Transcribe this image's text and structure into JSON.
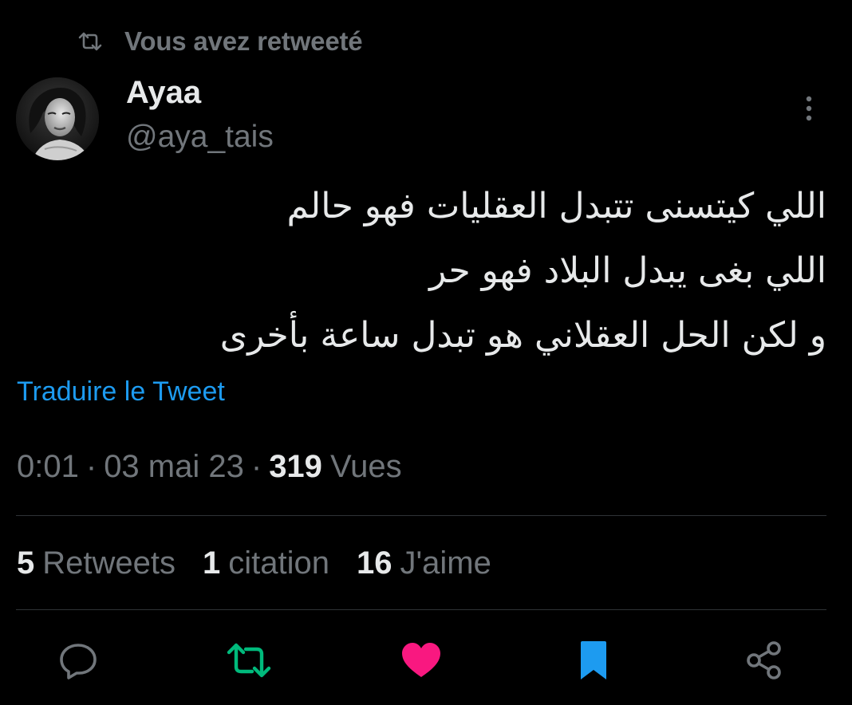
{
  "retweet_context": {
    "icon": "retweet-icon",
    "text": "Vous avez retweeté"
  },
  "author": {
    "display_name": "Ayaa",
    "handle": "@aya_tais",
    "avatar": "avatar-photo"
  },
  "more_icon": "more-vertical-icon",
  "tweet": {
    "lines": [
      "اللي كيتسنى تتبدل العقليات فهو حالم",
      "اللي بغى يبدل البلاد فهو حر",
      "و لكن الحل العقلاني هو تبدل ساعة بأخرى"
    ],
    "translate_label": "Traduire le Tweet"
  },
  "meta": {
    "time": "0:01",
    "separator": "·",
    "date": "03 mai 23",
    "views_count": "319",
    "views_label": "Vues"
  },
  "stats": {
    "retweets_count": "5",
    "retweets_label": "Retweets",
    "quotes_count": "1",
    "quotes_label": "citation",
    "likes_count": "16",
    "likes_label": "J'aime"
  },
  "actions": [
    {
      "name": "reply-icon",
      "color": "#71767b"
    },
    {
      "name": "retweet-icon",
      "color": "#00ba7c"
    },
    {
      "name": "like-icon",
      "color": "#f91880"
    },
    {
      "name": "bookmark-icon",
      "color": "#1d9bf0"
    },
    {
      "name": "share-icon",
      "color": "#71767b"
    }
  ],
  "colors": {
    "background": "#000000",
    "primary_text": "#e7e9ea",
    "secondary_text": "#71767b",
    "link": "#1d9bf0",
    "retweet_active": "#00ba7c",
    "like_active": "#f91880",
    "bookmark_active": "#1d9bf0",
    "divider": "#2f3336"
  }
}
